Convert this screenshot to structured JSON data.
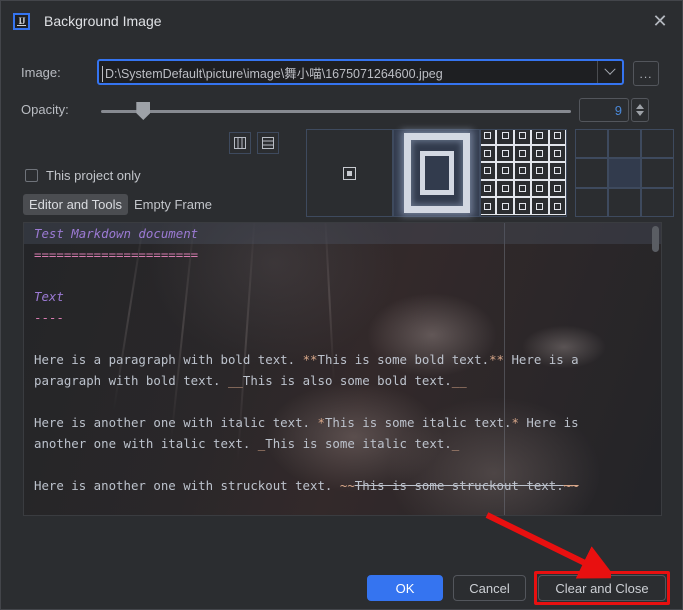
{
  "window": {
    "title": "Background Image",
    "app_icon": "intellij-idea-icon",
    "close_icon": "close-icon"
  },
  "form": {
    "image_label": "Image:",
    "image_path": "D:\\SystemDefault\\picture\\image\\舞小喵\\1675071264600.jpeg",
    "image_dropdown_icon": "chevron-down-icon",
    "browse_label": "...",
    "opacity_label": "Opacity:",
    "opacity_value": "9",
    "opacity_percent": 9,
    "this_project_only_label": "This project only",
    "this_project_only_checked": false
  },
  "tabs": [
    {
      "label": "Editor and Tools",
      "selected": true
    },
    {
      "label": "Empty Frame",
      "selected": false
    }
  ],
  "split_buttons": [
    {
      "name": "split-vertical-icon"
    },
    {
      "name": "split-horizontal-icon"
    }
  ],
  "fill_modes": [
    {
      "name": "center-fill-icon",
      "selected": false
    },
    {
      "name": "scale-fill-icon",
      "selected": true
    },
    {
      "name": "tile-fill-icon",
      "selected": false
    }
  ],
  "anchor_grid": {
    "cells": [
      "top-left",
      "top-center",
      "top-right",
      "middle-left",
      "middle-center",
      "middle-right",
      "bottom-left",
      "bottom-center",
      "bottom-right"
    ],
    "selected": "middle-center"
  },
  "editor_preview": {
    "lines": [
      {
        "text": "Test Markdown document",
        "style": "hdr"
      },
      {
        "text": "======================",
        "style": "rule"
      },
      {
        "text": "",
        "style": "plain"
      },
      {
        "text": "Text",
        "style": "hdr"
      },
      {
        "text": "----",
        "style": "rule"
      },
      {
        "text": "",
        "style": "plain"
      },
      {
        "text": "Here is a paragraph with bold text. **This is some bold text.** Here is a",
        "style": "plain"
      },
      {
        "text": "paragraph with bold text. __This is also some bold text.__",
        "style": "plain"
      },
      {
        "text": "",
        "style": "plain"
      },
      {
        "text": "Here is another one with italic text. *This is some italic text.* Here is",
        "style": "plain"
      },
      {
        "text": "another one with italic text. _This is some italic text._",
        "style": "plain"
      },
      {
        "text": "",
        "style": "plain"
      },
      {
        "text": "Here is another one with struckout text. ~~This is some struckout text.~~",
        "style": "plain"
      }
    ]
  },
  "buttons": {
    "ok": "OK",
    "cancel": "Cancel",
    "clear_and_close": "Clear and Close"
  },
  "annotation": {
    "highlight_color": "#e81010",
    "arrow_color": "#e81010",
    "target": "clear-and-close-button"
  },
  "colors": {
    "dialog_bg": "#2b2d30",
    "accent_blue": "#3574f0",
    "field_bg": "#1e1f22",
    "text": "#dfe1e5"
  }
}
